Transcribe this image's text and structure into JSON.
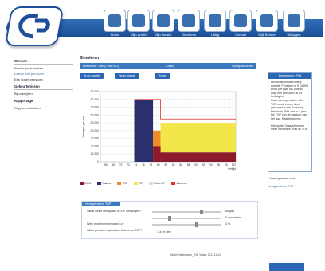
{
  "nav": [
    {
      "label": "Home",
      "icon": "home-icon"
    },
    {
      "label": "Mijn profiel",
      "icon": "profile-icon"
    },
    {
      "label": "Mijn dossier",
      "icon": "dossier-icon"
    },
    {
      "label": "Simuleren",
      "icon": "chart-icon"
    },
    {
      "label": "Uitleg",
      "icon": "help-icon"
    },
    {
      "label": "Contact",
      "icon": "mail-icon"
    },
    {
      "label": "Wijk Beheer",
      "icon": "gear-icon"
    },
    {
      "label": "Uitloggen",
      "icon": "logout-icon"
    }
  ],
  "left": {
    "sections": [
      {
        "title": "Wensen",
        "items": [
          "Eerder gaan werken",
          "Eerder met pensioen",
          "Een hoger pensioen"
        ]
      },
      {
        "title": "Gebeurtenissen",
        "items": [
          "Bij overlijden"
        ]
      },
      {
        "title": "Rapportage",
        "items": [
          "Rapport afdrukken"
        ]
      }
    ]
  },
  "main": {
    "title": "Simuleren",
    "bar_left": "Deelnemer: Piet (71567287)",
    "bar_mid": "Depot",
    "bar_right": "Doorgaan Model",
    "buttons": [
      "Bruto grafiek",
      "Netto grafiek",
      "Tabel"
    ],
    "y_axis_label": "bedragen per jaar",
    "x_axis_label": "leeftijd"
  },
  "chart_data": {
    "type": "area",
    "x": [
      "",
      "66",
      "67",
      "68",
      "69",
      "70",
      "71",
      "72",
      "73",
      "74",
      "75",
      "76",
      "77",
      "78",
      "79",
      "80",
      "81",
      "82",
      "83",
      "84",
      "85",
      "86",
      "87",
      "88",
      "89",
      "90",
      "91",
      "92",
      "93",
      "94",
      "95",
      "96",
      "97",
      "98",
      "99",
      "100"
    ],
    "yticks": [
      "90.000",
      "80.000",
      "70.000",
      "60.000",
      "50.000",
      "40.000",
      "30.000",
      "20.000",
      "10.000",
      "0"
    ],
    "ylim": [
      0,
      90000
    ],
    "series": [
      {
        "name": "AOW",
        "color": "#8b1a2b"
      },
      {
        "name": "Salaris",
        "color": "#2a2f6e"
      },
      {
        "name": "TOP",
        "color": "#f08a24"
      },
      {
        "name": "OP",
        "color": "#f2e64a"
      },
      {
        "name": "Extra OP",
        "color": "#ddd"
      },
      {
        "name": "Inkomen",
        "color": "#e03030"
      }
    ]
  },
  "panel": {
    "title": "Vroegpensioen TOP",
    "rows": [
      {
        "label": "Vanaf welke leeftijd wilt u TOP ontvangen?",
        "value": "65 jaar"
      },
      {
        "label": "",
        "value": "0 maand(en)"
      },
      {
        "label": "Welk rendement verwacht u?",
        "value": "3 %"
      },
      {
        "label": "Wilt u pensioen opbouwen tijdens uw TOP?",
        "radio_yes": "Ja",
        "radio_no": "Nee"
      }
    ]
  },
  "footer": "Model: Nederlands_TNO   Versie: 2013-11-12",
  "right": {
    "title": "Deelnemen: Piet",
    "p1": "Het pensioen aanvulling kostekt. Pensioen is € 14.690 bruto per jaar. Als u de 65 mag met pensioen, is dit bedrag het Ouderdomspensioen. Met TOP wordt er een deel gespaard in het Voorlopig Pensioen. Wilt u er in 1 jaar. De TOP van de jaarloon van het jaar. Haal betekenis.",
    "p2": "Klik op het Vraagteken om meer informatie over de TOP.",
    "link_title": "U heeft gekozen voor:",
    "link": "Vroegpensioen TOP"
  }
}
